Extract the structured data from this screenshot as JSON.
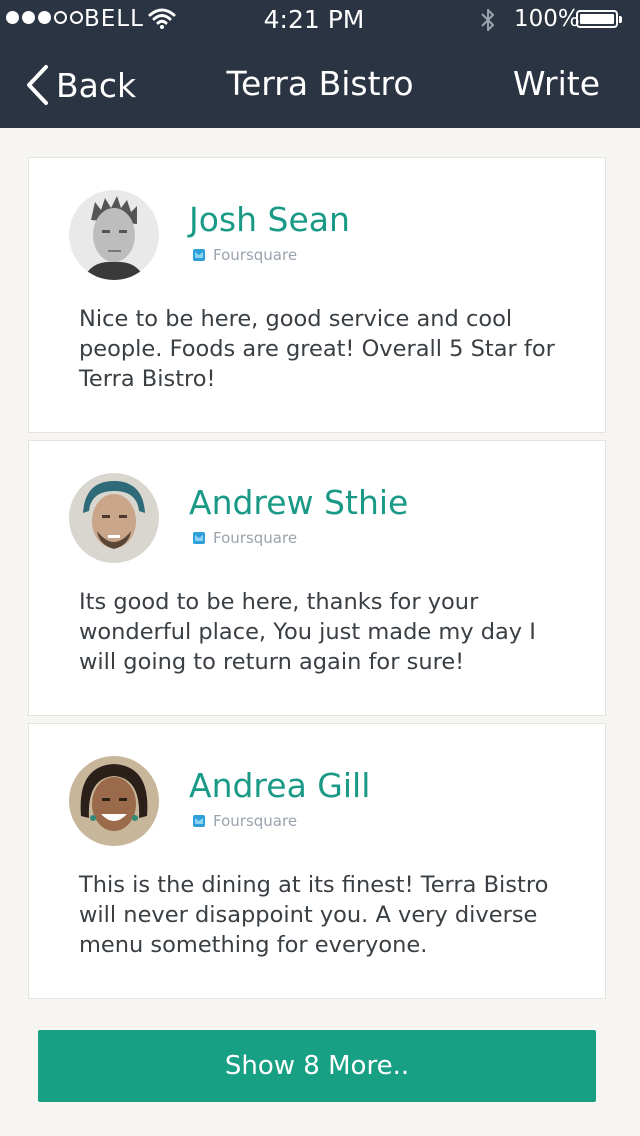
{
  "status_bar": {
    "carrier": "BELL",
    "time": "4:21 PM",
    "battery": "100%",
    "signal_bars_filled": 3,
    "signal_bars_total": 5
  },
  "nav": {
    "back_label": "Back",
    "title": "Terra Bistro",
    "write_label": "Write"
  },
  "reviews": [
    {
      "name": "Josh Sean",
      "source": "Foursquare",
      "text": "Nice to be here, good service and cool people. Foods are great! Overall 5 Star for Terra Bistro!"
    },
    {
      "name": "Andrew Sthie",
      "source": "Foursquare",
      "text": "Its good to be here, thanks for your wonderful place, You just made my day I will going to return again for sure!"
    },
    {
      "name": "Andrea Gill",
      "source": "Foursquare",
      "text": "This is the dining at its finest! Terra Bistro will never disappoint you. A very diverse menu something for everyone."
    }
  ],
  "show_more_label": "Show 8 More..",
  "colors": {
    "header_bg": "#2b3442",
    "accent": "#18a085",
    "name_color": "#1a9a86",
    "page_bg": "#f6f5f1"
  },
  "icons": {
    "back": "chevron-left-icon",
    "wifi": "wifi-icon",
    "bluetooth": "bluetooth-icon",
    "battery": "battery-icon",
    "source": "foursquare-icon"
  }
}
